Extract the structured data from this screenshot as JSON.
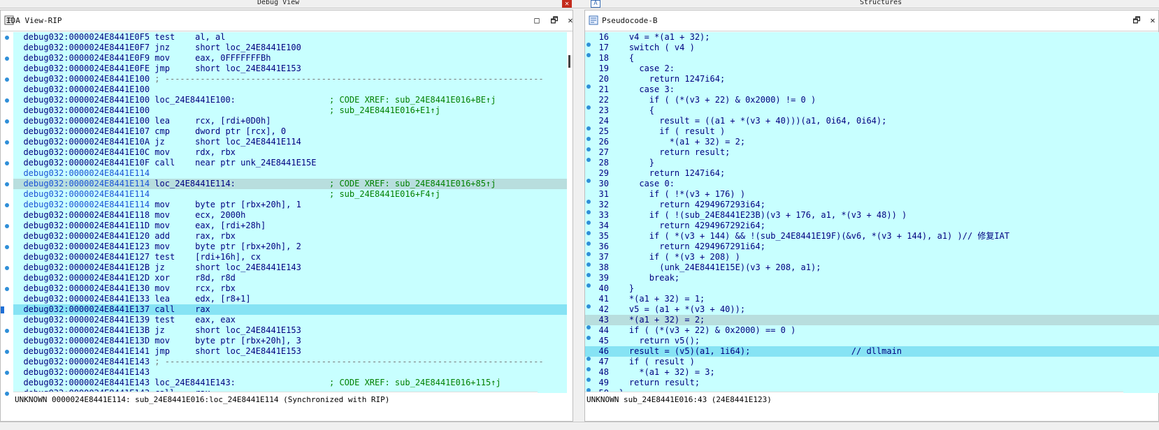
{
  "top": {
    "left_title": "Debug View",
    "right_title": "Structures",
    "close_glyph": "✕",
    "a_glyph": "A"
  },
  "left_pane": {
    "title": "IDA View-RIP",
    "controls": {
      "min": "□",
      "restore": "🗗",
      "close": "✕"
    },
    "lines": [
      {
        "a": "debug032:0000024E8441E0F5",
        "m": "test",
        "o": "al, al",
        "c": "",
        "k": "n"
      },
      {
        "a": "debug032:0000024E8441E0F7",
        "m": "jnz",
        "o": "short loc_24E8441E100",
        "c": "",
        "k": "n"
      },
      {
        "a": "debug032:0000024E8441E0F9",
        "m": "mov",
        "o": "eax, 0FFFFFFFBh",
        "c": "",
        "k": "n"
      },
      {
        "a": "debug032:0000024E8441E0FE",
        "m": "jmp",
        "o": "short loc_24E8441E153",
        "c": "",
        "k": "n"
      },
      {
        "a": "debug032:0000024E8441E100",
        "m": "; ---------------------------------------------------------------------------",
        "o": "",
        "c": "",
        "k": "sep"
      },
      {
        "a": "debug032:0000024E8441E100",
        "m": "",
        "o": "",
        "c": "",
        "k": "n"
      },
      {
        "a": "debug032:0000024E8441E100",
        "m": "loc_24E8441E100:",
        "o": "",
        "c": "; CODE XREF: sub_24E8441E016+BE↑j",
        "k": "lbl"
      },
      {
        "a": "debug032:0000024E8441E100",
        "m": "",
        "o": "",
        "c": "; sub_24E8441E016+E1↑j",
        "k": "lbl"
      },
      {
        "a": "debug032:0000024E8441E100",
        "m": "lea",
        "o": "rcx, [rdi+0D0h]",
        "c": "",
        "k": "n"
      },
      {
        "a": "debug032:0000024E8441E107",
        "m": "cmp",
        "o": "dword ptr [rcx], 0",
        "c": "",
        "k": "n"
      },
      {
        "a": "debug032:0000024E8441E10A",
        "m": "jz",
        "o": "short loc_24E8441E114",
        "c": "",
        "k": "n"
      },
      {
        "a": "debug032:0000024E8441E10C",
        "m": "mov",
        "o": "rdx, rbx",
        "c": "",
        "k": "n"
      },
      {
        "a": "debug032:0000024E8441E10F",
        "m": "call",
        "o": "near ptr unk_24E8441E15E",
        "c": "",
        "k": "n"
      },
      {
        "a": "debug032:0000024E8441E114",
        "m": "",
        "o": "",
        "c": "",
        "k": "b"
      },
      {
        "a": "debug032:0000024E8441E114",
        "m": "loc_24E8441E114:",
        "o": "",
        "c": "; CODE XREF: sub_24E8441E016+85↑j",
        "k": "hl"
      },
      {
        "a": "debug032:0000024E8441E114",
        "m": "",
        "o": "",
        "c": "; sub_24E8441E016+F4↑j",
        "k": "b"
      },
      {
        "a": "debug032:0000024E8441E114",
        "m": "mov",
        "o": "byte ptr [rbx+20h], 1",
        "c": "",
        "k": "b"
      },
      {
        "a": "debug032:0000024E8441E118",
        "m": "mov",
        "o": "ecx, 2000h",
        "c": "",
        "k": "n"
      },
      {
        "a": "debug032:0000024E8441E11D",
        "m": "mov",
        "o": "eax, [rdi+28h]",
        "c": "",
        "k": "n"
      },
      {
        "a": "debug032:0000024E8441E120",
        "m": "add",
        "o": "rax, rbx",
        "c": "",
        "k": "n"
      },
      {
        "a": "debug032:0000024E8441E123",
        "m": "mov",
        "o": "byte ptr [rbx+20h], 2",
        "c": "",
        "k": "n"
      },
      {
        "a": "debug032:0000024E8441E127",
        "m": "test",
        "o": "[rdi+16h], cx",
        "c": "",
        "k": "n"
      },
      {
        "a": "debug032:0000024E8441E12B",
        "m": "jz",
        "o": "short loc_24E8441E143",
        "c": "",
        "k": "n"
      },
      {
        "a": "debug032:0000024E8441E12D",
        "m": "xor",
        "o": "r8d, r8d",
        "c": "",
        "k": "n"
      },
      {
        "a": "debug032:0000024E8441E130",
        "m": "mov",
        "o": "rcx, rbx",
        "c": "",
        "k": "n"
      },
      {
        "a": "debug032:0000024E8441E133",
        "m": "lea",
        "o": "edx, [r8+1]",
        "c": "",
        "k": "n"
      },
      {
        "a": "debug032:0000024E8441E137",
        "m": "call",
        "o": "rax",
        "c": "",
        "k": "sel"
      },
      {
        "a": "debug032:0000024E8441E139",
        "m": "test",
        "o": "eax, eax",
        "c": "",
        "k": "n"
      },
      {
        "a": "debug032:0000024E8441E13B",
        "m": "jz",
        "o": "short loc_24E8441E153",
        "c": "",
        "k": "n"
      },
      {
        "a": "debug032:0000024E8441E13D",
        "m": "mov",
        "o": "byte ptr [rbx+20h], 3",
        "c": "",
        "k": "n"
      },
      {
        "a": "debug032:0000024E8441E141",
        "m": "jmp",
        "o": "short loc_24E8441E153",
        "c": "",
        "k": "n"
      },
      {
        "a": "debug032:0000024E8441E143",
        "m": "; ---------------------------------------------------------------------------",
        "o": "",
        "c": "",
        "k": "sep"
      },
      {
        "a": "debug032:0000024E8441E143",
        "m": "",
        "o": "",
        "c": "",
        "k": "n"
      },
      {
        "a": "debug032:0000024E8441E143",
        "m": "loc_24E8441E143:",
        "o": "",
        "c": "; CODE XREF: sub_24E8441E016+115↑j",
        "k": "lbl"
      },
      {
        "a": "debug032:0000024E8441E143",
        "m": "call",
        "o": "rax",
        "c": "",
        "k": "n"
      }
    ],
    "status": "UNKNOWN 0000024E8441E114: sub_24E8441E016:loc_24E8441E114 (Synchronized with RIP)"
  },
  "right_pane": {
    "title": "Pseudocode-B",
    "controls": {
      "restore": "🗗",
      "close": "✕"
    },
    "lines": [
      {
        "n": "16",
        "t": "  v4 = *(a1 + 32);",
        "k": "n"
      },
      {
        "n": "17",
        "t": "  switch ( v4 )",
        "k": "n"
      },
      {
        "n": "18",
        "t": "  {",
        "k": "n"
      },
      {
        "n": "19",
        "t": "    case 2:",
        "k": "n"
      },
      {
        "n": "20",
        "t": "      return 1247i64;",
        "k": "n"
      },
      {
        "n": "21",
        "t": "    case 3:",
        "k": "n"
      },
      {
        "n": "22",
        "t": "      if ( (*(v3 + 22) & 0x2000) != 0 )",
        "k": "n"
      },
      {
        "n": "23",
        "t": "      {",
        "k": "n"
      },
      {
        "n": "24",
        "t": "        result = ((a1 + *(v3 + 40)))(a1, 0i64, 0i64);",
        "k": "n"
      },
      {
        "n": "25",
        "t": "        if ( result )",
        "k": "n"
      },
      {
        "n": "26",
        "t": "          *(a1 + 32) = 2;",
        "k": "n"
      },
      {
        "n": "27",
        "t": "        return result;",
        "k": "n"
      },
      {
        "n": "28",
        "t": "      }",
        "k": "n"
      },
      {
        "n": "29",
        "t": "      return 1247i64;",
        "k": "n"
      },
      {
        "n": "30",
        "t": "    case 0:",
        "k": "n"
      },
      {
        "n": "31",
        "t": "      if ( !*(v3 + 176) )",
        "k": "n"
      },
      {
        "n": "32",
        "t": "        return 4294967293i64;",
        "k": "n"
      },
      {
        "n": "33",
        "t": "      if ( !(sub_24E8441E23B)(v3 + 176, a1, *(v3 + 48)) )",
        "k": "n"
      },
      {
        "n": "34",
        "t": "        return 4294967292i64;",
        "k": "n"
      },
      {
        "n": "35",
        "t": "      if ( *(v3 + 144) && !(sub_24E8441E19F)(&v6, *(v3 + 144), a1) )// 修复IAT",
        "k": "n"
      },
      {
        "n": "36",
        "t": "        return 4294967291i64;",
        "k": "n"
      },
      {
        "n": "37",
        "t": "      if ( *(v3 + 208) )",
        "k": "n"
      },
      {
        "n": "38",
        "t": "        (unk_24E8441E15E)(v3 + 208, a1);",
        "k": "n"
      },
      {
        "n": "39",
        "t": "      break;",
        "k": "n"
      },
      {
        "n": "40",
        "t": "  }",
        "k": "n"
      },
      {
        "n": "41",
        "t": "  *(a1 + 32) = 1;",
        "k": "n"
      },
      {
        "n": "42",
        "t": "  v5 = (a1 + *(v3 + 40));",
        "k": "n"
      },
      {
        "n": "43",
        "t": "  *(a1 + 32) = 2;",
        "k": "hl"
      },
      {
        "n": "44",
        "t": "  if ( (*(v3 + 22) & 0x2000) == 0 )",
        "k": "n"
      },
      {
        "n": "45",
        "t": "    return v5();",
        "k": "n"
      },
      {
        "n": "46",
        "t": "  result = (v5)(a1, 1i64);                    // dllmain",
        "k": "sel"
      },
      {
        "n": "47",
        "t": "  if ( result )",
        "k": "n"
      },
      {
        "n": "48",
        "t": "    *(a1 + 32) = 3;",
        "k": "n"
      },
      {
        "n": "49",
        "t": "  return result;",
        "k": "n"
      },
      {
        "n": "50",
        "t": "}",
        "k": "n"
      }
    ],
    "status": "UNKNOWN sub_24E8441E016:43 (24E8441E123)"
  }
}
